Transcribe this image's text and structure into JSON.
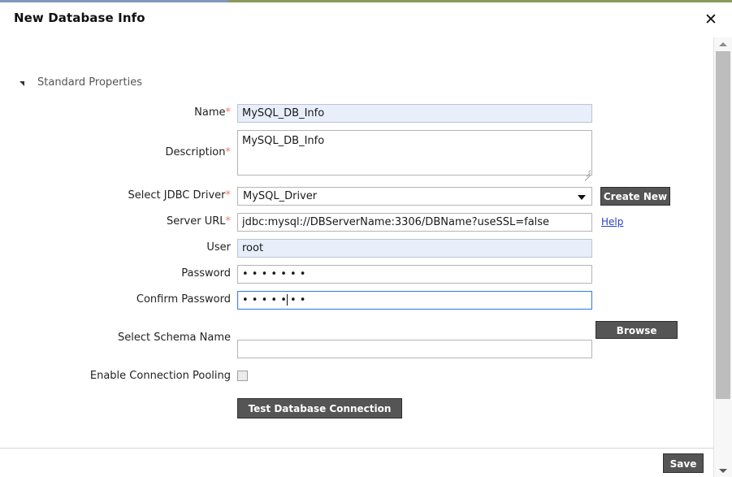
{
  "window": {
    "title": "New Database Info",
    "close_icon": "close-icon",
    "accent_left_color": "#8099bb",
    "accent_right_color": "#8a9a5b"
  },
  "section": {
    "title": "Standard Properties",
    "toggle_icon": "triangle-expanded-icon",
    "expanded": true
  },
  "fields": {
    "name": {
      "label": "Name",
      "required_marker": "*",
      "value": "MySQL_DB_Info",
      "placeholder": "",
      "readonly": true
    },
    "description": {
      "label": "Description",
      "required_marker": "*",
      "value": "MySQL_DB_Info",
      "placeholder": ""
    },
    "jdbc_driver": {
      "label": "Select JDBC Driver",
      "required_marker": "*",
      "value": "MySQL_Driver",
      "options": [
        "MySQL_Driver"
      ],
      "create_new_label": "Create New"
    },
    "server_url": {
      "label": "Server URL",
      "required_marker": "*",
      "value": "jdbc:mysql://DBServerName:3306/DBName?useSSL=false",
      "placeholder": "",
      "help_label": "Help"
    },
    "user": {
      "label": "User",
      "required_marker": "",
      "value": "root",
      "placeholder": "",
      "readonly": true
    },
    "password": {
      "label": "Password",
      "required_marker": "",
      "value": "• • • • • • •",
      "placeholder": ""
    },
    "confirm_password": {
      "label": "Confirm Password",
      "required_marker": "",
      "value": "• • • • • • •",
      "placeholder": "",
      "focused": true
    },
    "schema_name": {
      "label": "Select Schema Name",
      "required_marker": "",
      "value": "",
      "placeholder": "",
      "browse_label": "Browse Schema"
    },
    "connection_pooling": {
      "label": "Enable Connection Pooling",
      "checked": false
    }
  },
  "actions": {
    "test_connection_label": "Test Database Connection",
    "save_label": "Save"
  },
  "scrollbar": {
    "up_icon": "chevron-up-icon",
    "down_icon": "chevron-down-icon"
  }
}
